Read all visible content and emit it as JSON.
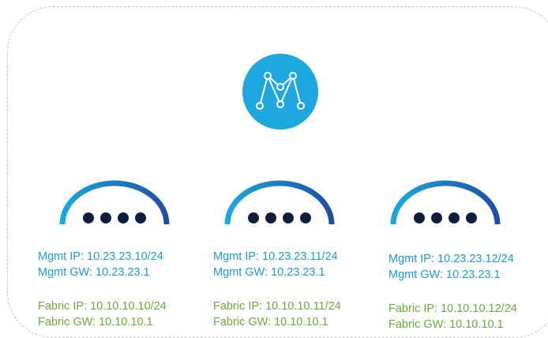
{
  "nodes": [
    {
      "mgmt_ip": "Mgmt IP: 10.23.23.10/24",
      "mgmt_gw": "Mgmt GW: 10.23.23.1",
      "fabric_ip": "Fabric IP: 10.10.10.10/24",
      "fabric_gw": "Fabric GW: 10.10.10.1"
    },
    {
      "mgmt_ip": "Mgmt IP: 10.23.23.11/24",
      "mgmt_gw": "Mgmt GW: 10.23.23.1",
      "fabric_ip": "Fabric IP: 10.10.10.11/24",
      "fabric_gw": "Fabric GW: 10.10.10.1"
    },
    {
      "mgmt_ip": "Mgmt IP: 10.23.23.12/24",
      "mgmt_gw": "Mgmt GW: 10.23.23.1",
      "fabric_ip": "Fabric IP: 10.10.10.12/24",
      "fabric_gw": "Fabric GW: 10.10.10.1"
    }
  ],
  "icons": {
    "hub": "mesh-network-icon",
    "node": "server-node-icon"
  },
  "colors": {
    "hub_fill": "#1fa8e0",
    "arc_start": "#1aa8de",
    "arc_end": "#1f4fa3",
    "dot": "#0e1f3d",
    "mgmt_text": "#1a9ad6",
    "fabric_text": "#6aaa3a",
    "frame_border": "#c4c4c4"
  }
}
